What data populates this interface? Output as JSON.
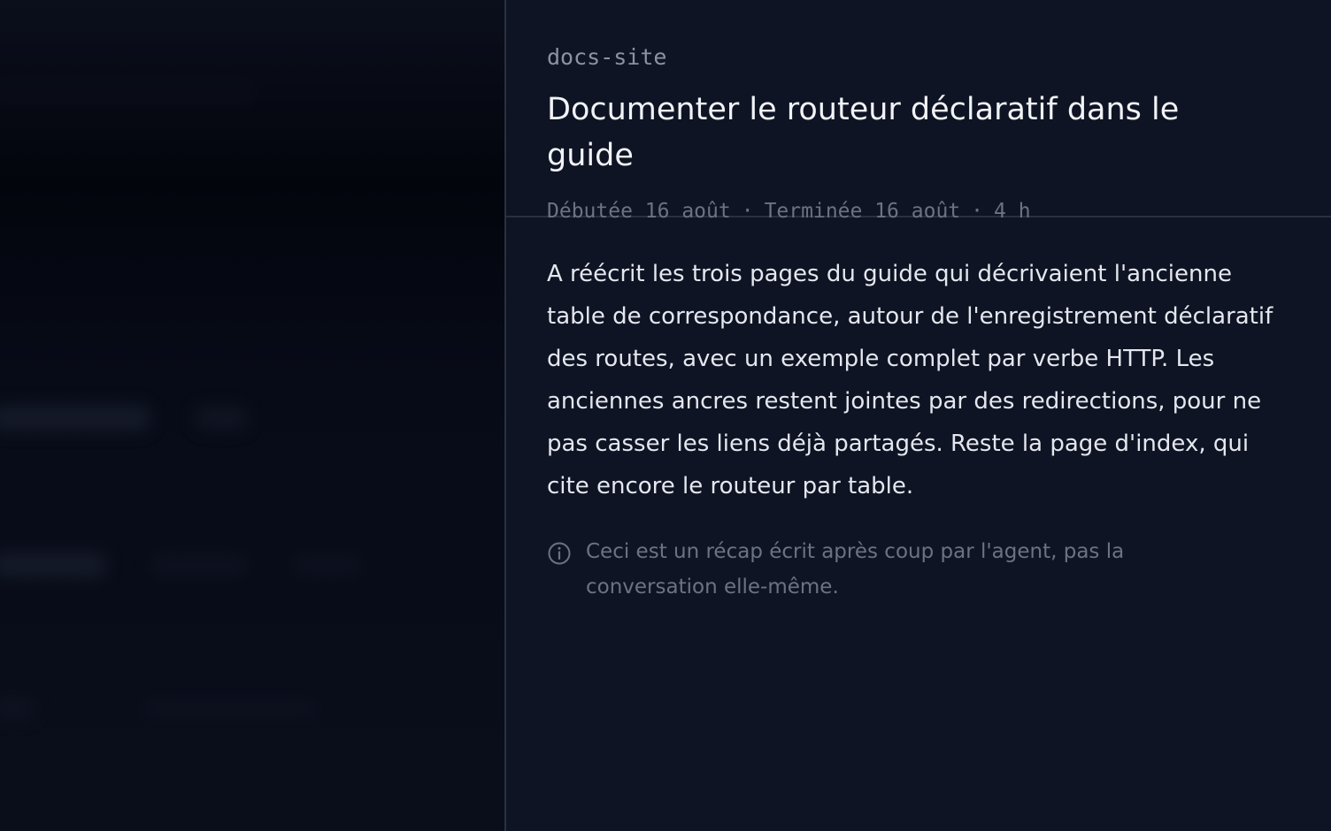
{
  "panel": {
    "repo": "docs-site",
    "title": "Documenter le routeur déclaratif dans le guide",
    "meta": {
      "started": "Débutée 16 août",
      "finished": "Terminée 16 août",
      "duration": "4 h",
      "separator": "·"
    },
    "summary": "A réécrit les trois pages du guide qui décrivaient l'ancienne table de correspondance, autour de l'enregistrement déclaratif des routes, avec un exemple complet par verbe HTTP. Les anciennes ancres restent jointes par des redirections, pour ne pas casser les liens déjà partagés. Reste la page d'index, qui cite encore le routeur par table.",
    "note": {
      "icon": "info-icon",
      "text": "Ceci est un récap écrit après coup par l'agent, pas la conversation elle-même."
    }
  },
  "colors": {
    "panel_bg": "#0f1424",
    "text_primary": "#f1f3f7",
    "text_muted": "#6a7384",
    "divider": "#2a3040"
  }
}
